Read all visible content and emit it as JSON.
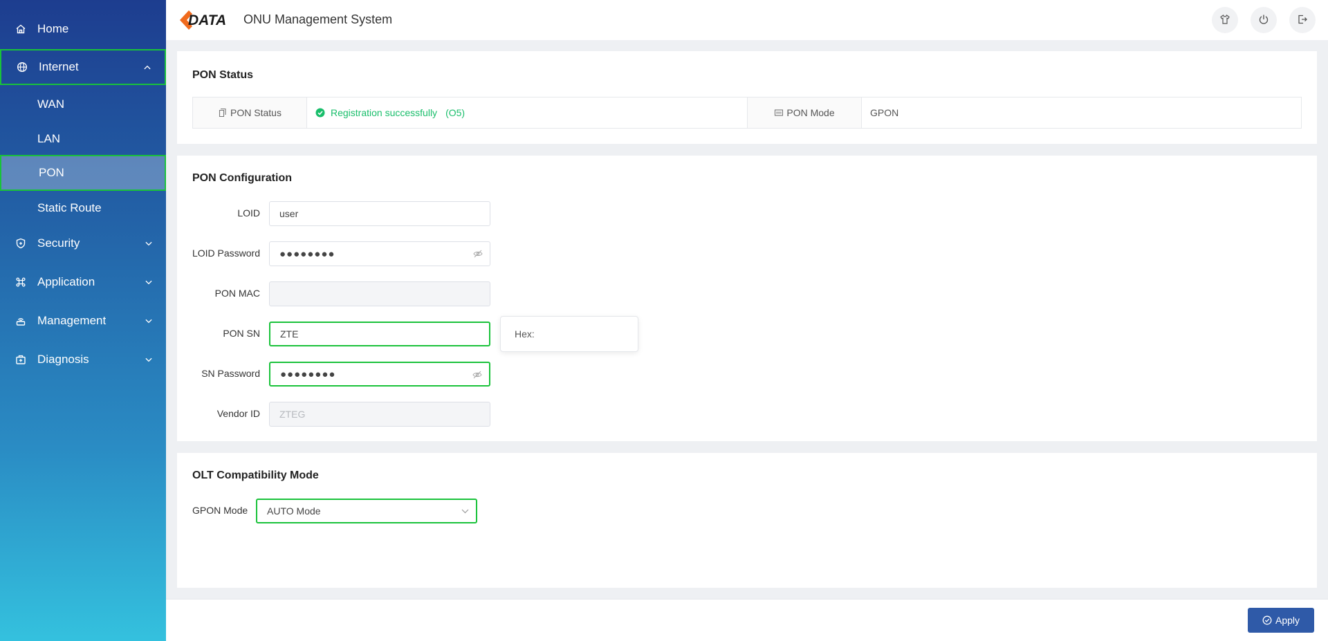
{
  "header": {
    "logo_text": "DATA",
    "title": "ONU Management System",
    "buttons": {
      "theme": "shirt-icon",
      "power": "power-icon",
      "logout": "logout-icon"
    }
  },
  "sidebar": {
    "items": [
      {
        "label": "Home",
        "icon": "home-icon"
      },
      {
        "label": "Internet",
        "icon": "globe-icon",
        "expanded": true
      },
      {
        "label": "WAN"
      },
      {
        "label": "LAN"
      },
      {
        "label": "PON",
        "active": true
      },
      {
        "label": "Static Route"
      },
      {
        "label": "Security",
        "icon": "shield-icon"
      },
      {
        "label": "Application",
        "icon": "command-icon"
      },
      {
        "label": "Management",
        "icon": "router-icon"
      },
      {
        "label": "Diagnosis",
        "icon": "medkit-icon"
      }
    ]
  },
  "pon_status": {
    "title": "PON Status",
    "status_label": "PON Status",
    "status_value": "Registration successfully",
    "status_state": "(O5)",
    "mode_label": "PON Mode",
    "mode_value": "GPON",
    "success_color": "#19be6b"
  },
  "pon_config": {
    "title": "PON Configuration",
    "loid_label": "LOID",
    "loid_value": "user",
    "loid_password_label": "LOID Password",
    "loid_password_value": "●●●●●●●●",
    "pon_mac_label": "PON MAC",
    "pon_mac_value": "",
    "pon_sn_label": "PON SN",
    "pon_sn_value": "ZTE",
    "hex_label": "Hex:",
    "sn_password_label": "SN Password",
    "sn_password_value": "●●●●●●●●",
    "vendor_id_label": "Vendor ID",
    "vendor_id_value": "ZTEG"
  },
  "olt": {
    "title": "OLT Compatibility Mode",
    "gpon_mode_label": "GPON Mode",
    "gpon_mode_value": "AUTO Mode"
  },
  "footer": {
    "apply_label": "Apply"
  },
  "colors": {
    "accent": "#2f5aa8",
    "highlight": "#19c23a",
    "logo_orange": "#f06a1d"
  }
}
